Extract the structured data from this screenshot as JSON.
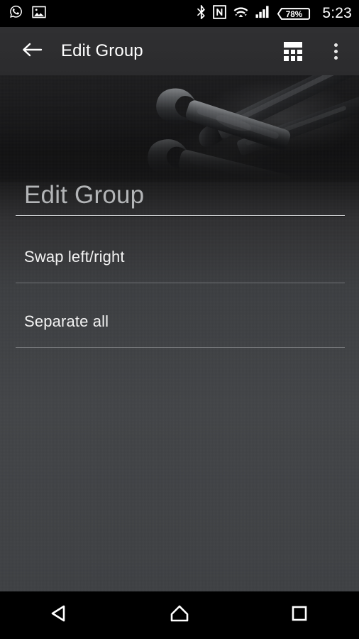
{
  "status_bar": {
    "left_icons": [
      {
        "name": "whatsapp-icon",
        "label": "WhatsApp"
      },
      {
        "name": "image-icon",
        "label": "Screenshot"
      }
    ],
    "right_icons": [
      {
        "name": "bluetooth-icon",
        "label": "Bluetooth"
      },
      {
        "name": "nfc-icon",
        "label": "NFC"
      },
      {
        "name": "wifi-icon",
        "label": "Wi-Fi"
      },
      {
        "name": "cellular-signal-icon",
        "label": "Signal"
      }
    ],
    "battery": "78%",
    "time": "5:23"
  },
  "app_bar": {
    "back_label": "Back",
    "title": "Edit Group",
    "grid_label": "Keypad",
    "overflow_label": "More options"
  },
  "dialog": {
    "title": "Edit Group",
    "items": [
      {
        "label": "Swap left/right"
      },
      {
        "label": "Separate all"
      }
    ]
  },
  "nav_bar": {
    "back_label": "Back",
    "home_label": "Home",
    "recents_label": "Recent apps"
  },
  "colors": {
    "status_bar_bg": "#000000",
    "app_bar_bg": "#2e2e30",
    "content_bg": "#434548",
    "text_primary": "#f2f2f2",
    "text_dim": "#b3b5b7",
    "divider": "#c9cbcd",
    "nav_bar_bg": "#000000"
  }
}
